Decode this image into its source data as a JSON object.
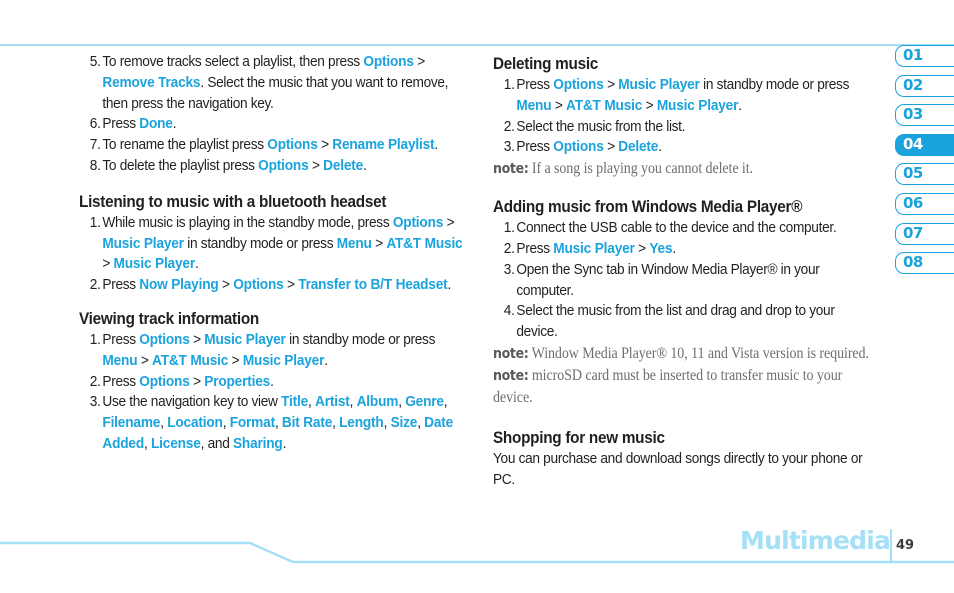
{
  "colors": {
    "accent": "#1aa3dc",
    "rule": "#a6e0f6",
    "body_text": "#231f20",
    "note_text": "#6d6e71"
  },
  "left_column": {
    "steps_intro": [
      {
        "num": "5.",
        "parts": [
          {
            "t": "To remove tracks select a playlist, then press "
          },
          {
            "t": "Options",
            "hl": true
          },
          {
            "t": " > "
          },
          {
            "t": "Remove Tracks",
            "hl": true
          },
          {
            "t": ". Select the music that you want to remove, then press the navigation key."
          }
        ]
      },
      {
        "num": "6.",
        "parts": [
          {
            "t": "Press "
          },
          {
            "t": "Done",
            "hl": true
          },
          {
            "t": "."
          }
        ]
      },
      {
        "num": "7.",
        "parts": [
          {
            "t": "To rename the playlist press "
          },
          {
            "t": "Options",
            "hl": true
          },
          {
            "t": " > "
          },
          {
            "t": "Rename Playlist",
            "hl": true
          },
          {
            "t": "."
          }
        ]
      },
      {
        "num": "8.",
        "parts": [
          {
            "t": "To delete the playlist press "
          },
          {
            "t": "Options",
            "hl": true
          },
          {
            "t": " > "
          },
          {
            "t": "Delete",
            "hl": true
          },
          {
            "t": "."
          }
        ]
      }
    ],
    "bluetooth": {
      "heading": "Listening to music with a bluetooth headset",
      "steps": [
        {
          "num": "1.",
          "parts": [
            {
              "t": "While music is playing in the standby mode, press "
            },
            {
              "t": "Options",
              "hl": true
            },
            {
              "t": " > "
            },
            {
              "t": "Music Player",
              "hl": true
            },
            {
              "t": " in standby mode or press "
            },
            {
              "t": "Menu",
              "hl": true
            },
            {
              "t": " > "
            },
            {
              "t": "AT&T Music",
              "hl": true
            },
            {
              "t": " > "
            },
            {
              "t": "Music Player",
              "hl": true
            },
            {
              "t": "."
            }
          ]
        },
        {
          "num": "2.",
          "parts": [
            {
              "t": "Press "
            },
            {
              "t": "Now Playing",
              "hl": true
            },
            {
              "t": " > "
            },
            {
              "t": "Options",
              "hl": true
            },
            {
              "t": " > "
            },
            {
              "t": "Transfer to B/T Headset",
              "hl": true
            },
            {
              "t": "."
            }
          ]
        }
      ]
    },
    "track_info": {
      "heading": "Viewing track information",
      "steps": [
        {
          "num": "1.",
          "parts": [
            {
              "t": "Press "
            },
            {
              "t": "Options",
              "hl": true
            },
            {
              "t": " > "
            },
            {
              "t": "Music Player",
              "hl": true
            },
            {
              "t": " in standby mode or press "
            },
            {
              "t": "Menu",
              "hl": true
            },
            {
              "t": " > "
            },
            {
              "t": "AT&T Music",
              "hl": true
            },
            {
              "t": " > "
            },
            {
              "t": "Music Player",
              "hl": true
            },
            {
              "t": "."
            }
          ]
        },
        {
          "num": "2.",
          "parts": [
            {
              "t": "Press "
            },
            {
              "t": "Options",
              "hl": true
            },
            {
              "t": " > "
            },
            {
              "t": "Properties",
              "hl": true
            },
            {
              "t": "."
            }
          ]
        },
        {
          "num": "3.",
          "parts": [
            {
              "t": "Use the navigation key to view "
            },
            {
              "t": "Title",
              "hl": true
            },
            {
              "t": ", "
            },
            {
              "t": "Artist",
              "hl": true
            },
            {
              "t": ", "
            },
            {
              "t": "Album",
              "hl": true
            },
            {
              "t": ", "
            },
            {
              "t": "Genre",
              "hl": true
            },
            {
              "t": ", "
            },
            {
              "t": "Filename",
              "hl": true
            },
            {
              "t": ", "
            },
            {
              "t": "Location",
              "hl": true
            },
            {
              "t": ", "
            },
            {
              "t": "Format",
              "hl": true
            },
            {
              "t": ", "
            },
            {
              "t": "Bit Rate",
              "hl": true
            },
            {
              "t": ", "
            },
            {
              "t": "Length",
              "hl": true
            },
            {
              "t": ", "
            },
            {
              "t": "Size",
              "hl": true
            },
            {
              "t": ", "
            },
            {
              "t": "Date Added",
              "hl": true
            },
            {
              "t": ", "
            },
            {
              "t": "License",
              "hl": true
            },
            {
              "t": ", and "
            },
            {
              "t": "Sharing",
              "hl": true
            },
            {
              "t": "."
            }
          ]
        }
      ]
    }
  },
  "right_column": {
    "deleting": {
      "heading": "Deleting music",
      "steps": [
        {
          "num": "1.",
          "parts": [
            {
              "t": "Press "
            },
            {
              "t": "Options",
              "hl": true
            },
            {
              "t": " > "
            },
            {
              "t": "Music Player",
              "hl": true
            },
            {
              "t": " in standby mode or press "
            },
            {
              "t": "Menu",
              "hl": true
            },
            {
              "t": " > "
            },
            {
              "t": "AT&T Music",
              "hl": true
            },
            {
              "t": " > "
            },
            {
              "t": "Music Player",
              "hl": true
            },
            {
              "t": "."
            }
          ]
        },
        {
          "num": "2.",
          "parts": [
            {
              "t": "Select the music from the list."
            }
          ]
        },
        {
          "num": "3.",
          "parts": [
            {
              "t": "Press "
            },
            {
              "t": "Options",
              "hl": true
            },
            {
              "t": " > "
            },
            {
              "t": "Delete",
              "hl": true
            },
            {
              "t": "."
            }
          ]
        }
      ],
      "note_label": "note:",
      "note_text": " If a song is playing you cannot delete it."
    },
    "wmp": {
      "heading": "Adding music from Windows Media Player®",
      "steps": [
        {
          "num": "1.",
          "parts": [
            {
              "t": "Connect the USB cable to the device and the computer."
            }
          ]
        },
        {
          "num": "2.",
          "parts": [
            {
              "t": "Press "
            },
            {
              "t": "Music Player",
              "hl": true
            },
            {
              "t": " > "
            },
            {
              "t": "Yes",
              "hl": true
            },
            {
              "t": "."
            }
          ]
        },
        {
          "num": "3.",
          "parts": [
            {
              "t": "Open the Sync tab in Window Media Player® in your computer."
            }
          ]
        },
        {
          "num": "4.",
          "parts": [
            {
              "t": "Select the music from the list and drag and drop to your device."
            }
          ]
        }
      ],
      "notes": [
        {
          "label": "note:",
          "text": " Window Media Player® 10, 11 and Vista version is required."
        },
        {
          "label": "note:",
          "text": " microSD card must be inserted to transfer music to your device."
        }
      ]
    },
    "shopping": {
      "heading": "Shopping for new music",
      "body": "You can purchase and download  songs directly to your phone or PC."
    }
  },
  "chapter_tabs": [
    {
      "label": "01",
      "active": false
    },
    {
      "label": "02",
      "active": false
    },
    {
      "label": "03",
      "active": false
    },
    {
      "label": "04",
      "active": true
    },
    {
      "label": "05",
      "active": false
    },
    {
      "label": "06",
      "active": false
    },
    {
      "label": "07",
      "active": false
    },
    {
      "label": "08",
      "active": false
    }
  ],
  "footer": {
    "section_title": "Multimedia",
    "page_number": "49"
  }
}
